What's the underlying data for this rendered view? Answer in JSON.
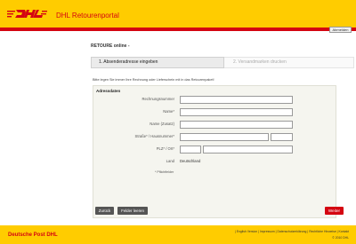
{
  "header": {
    "logo_text": "DHL",
    "portal_title": "DHL Retourenportal",
    "logout_label": "Abmelden"
  },
  "page": {
    "title": "RETOURE online -",
    "steps": [
      {
        "label": "1. Absenderadresse eingeben",
        "active": true
      },
      {
        "label": "2. Versandmarken drucken",
        "active": false
      }
    ],
    "hint": "Bitte legen Sie immer Ihre Rechnung oder Lieferschein mit in das Retourenpaket!"
  },
  "form": {
    "section_title": "Adressdaten",
    "fields": {
      "rechnungsnummer": {
        "label": "Rechnungsnummer",
        "value": ""
      },
      "name": {
        "label": "Name*",
        "value": ""
      },
      "name_zusatz": {
        "label": "Name (Zusatz)",
        "value": ""
      },
      "strasse": {
        "label": "Straße* / Hausnummer*",
        "street_value": "",
        "number_value": ""
      },
      "plz_ort": {
        "label": "PLZ* / Ort*",
        "plz_value": "",
        "ort_value": ""
      },
      "land": {
        "label": "Land",
        "value": "Deutschland"
      }
    },
    "required_note": "* Pflichtfelder",
    "buttons": {
      "back": "Zurück",
      "clear": "Felder leeren",
      "next": "Weiter"
    }
  },
  "footer": {
    "brand": "Deutsche Post DHL",
    "links": [
      "English Version",
      "Impressum",
      "Datenschutzerklärung",
      "Rechtliche Hinweise",
      "Kontakt"
    ],
    "copyright": "© 2010 DHL"
  },
  "colors": {
    "brand_yellow": "#ffcc00",
    "brand_red": "#d40511",
    "button_grey": "#555555"
  }
}
